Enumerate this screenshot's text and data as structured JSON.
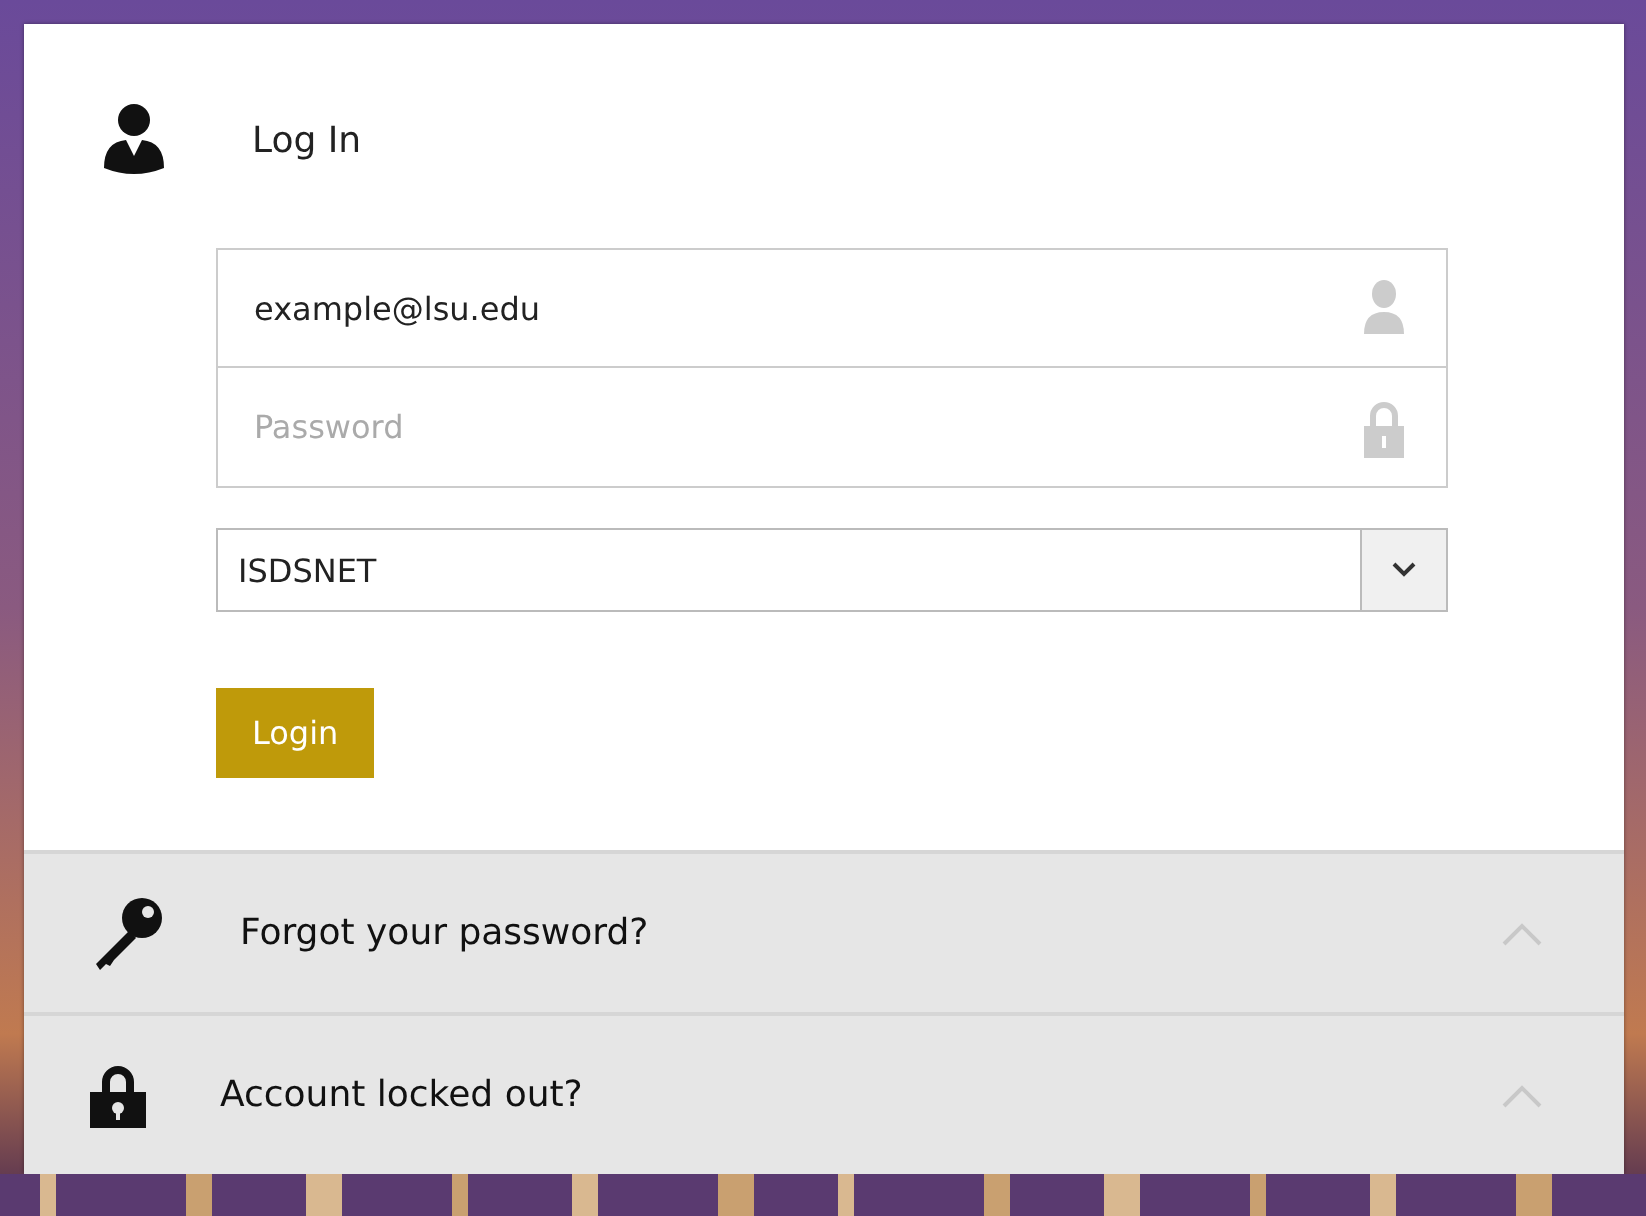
{
  "login": {
    "title": "Log In",
    "email": {
      "value": "example@lsu.edu"
    },
    "password": {
      "placeholder": "Password"
    },
    "domain": {
      "value": "ISDSNET"
    },
    "button": "Login"
  },
  "sections": [
    {
      "kind": "key",
      "label": "Forgot your password?",
      "expanded": false
    },
    {
      "kind": "lock",
      "label": "Account locked out?",
      "expanded": false
    }
  ]
}
